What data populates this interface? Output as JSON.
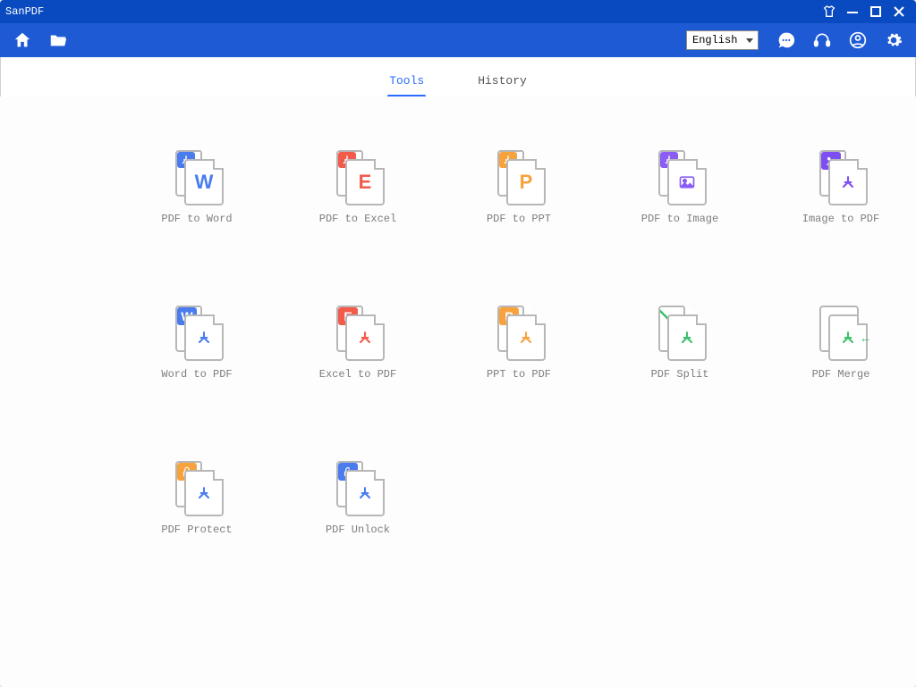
{
  "app": {
    "title": "SanPDF"
  },
  "toolbar": {
    "language_selected": "English",
    "language_options": [
      "English"
    ]
  },
  "tabs": {
    "tools": "Tools",
    "history": "History",
    "active": "tools"
  },
  "tools": [
    {
      "id": "pdf-to-word",
      "label": "PDF to Word",
      "badge_color": "#4a7cf0",
      "letter": "W",
      "letter_color": "#4a7cf0",
      "front_glyph": "letter",
      "style": "convert-from-pdf"
    },
    {
      "id": "pdf-to-excel",
      "label": "PDF to Excel",
      "badge_color": "#f25a4a",
      "letter": "E",
      "letter_color": "#f25a4a",
      "front_glyph": "letter",
      "style": "convert-from-pdf"
    },
    {
      "id": "pdf-to-ppt",
      "label": "PDF to PPT",
      "badge_color": "#f7a23c",
      "letter": "P",
      "letter_color": "#f7a23c",
      "front_glyph": "letter",
      "style": "convert-from-pdf"
    },
    {
      "id": "pdf-to-image",
      "label": "PDF to Image",
      "badge_color": "#8b5cf6",
      "letter": "",
      "letter_color": "#8b5cf6",
      "front_glyph": "image",
      "style": "convert-from-pdf"
    },
    {
      "id": "image-to-pdf",
      "label": "Image to PDF",
      "badge_color": "#7d4ff2",
      "letter": "",
      "letter_color": "#7d4ff2",
      "front_glyph": "pdf",
      "style": "convert-to-pdf-image"
    },
    {
      "id": "word-to-pdf",
      "label": "Word to PDF",
      "badge_color": "#4a7cf0",
      "letter": "W",
      "letter_color": "#4a7cf0",
      "front_glyph": "pdf",
      "style": "convert-to-pdf"
    },
    {
      "id": "excel-to-pdf",
      "label": "Excel to PDF",
      "badge_color": "#f25a4a",
      "letter": "E",
      "letter_color": "#f25a4a",
      "front_glyph": "pdf",
      "style": "convert-to-pdf"
    },
    {
      "id": "ppt-to-pdf",
      "label": "PPT to PDF",
      "badge_color": "#f7a23c",
      "letter": "P",
      "letter_color": "#f7a23c",
      "front_glyph": "pdf",
      "style": "convert-to-pdf"
    },
    {
      "id": "pdf-split",
      "label": "PDF Split",
      "badge_color": "",
      "letter": "",
      "letter_color": "#3cc06a",
      "front_glyph": "pdf",
      "style": "split"
    },
    {
      "id": "pdf-merge",
      "label": "PDF Merge",
      "badge_color": "",
      "letter": "",
      "letter_color": "#3cc06a",
      "front_glyph": "pdf",
      "style": "merge"
    },
    {
      "id": "pdf-protect",
      "label": "PDF Protect",
      "badge_color": "#f7a23c",
      "letter": "",
      "letter_color": "#4a7cf0",
      "front_glyph": "pdf",
      "style": "protect"
    },
    {
      "id": "pdf-unlock",
      "label": "PDF Unlock",
      "badge_color": "#4a7cf0",
      "letter": "",
      "letter_color": "#4a7cf0",
      "front_glyph": "pdf",
      "style": "unlock"
    }
  ],
  "colors": {
    "brand": "#1e5ad4",
    "titlebar": "#0a4ac0",
    "accent": "#2a6cff"
  }
}
